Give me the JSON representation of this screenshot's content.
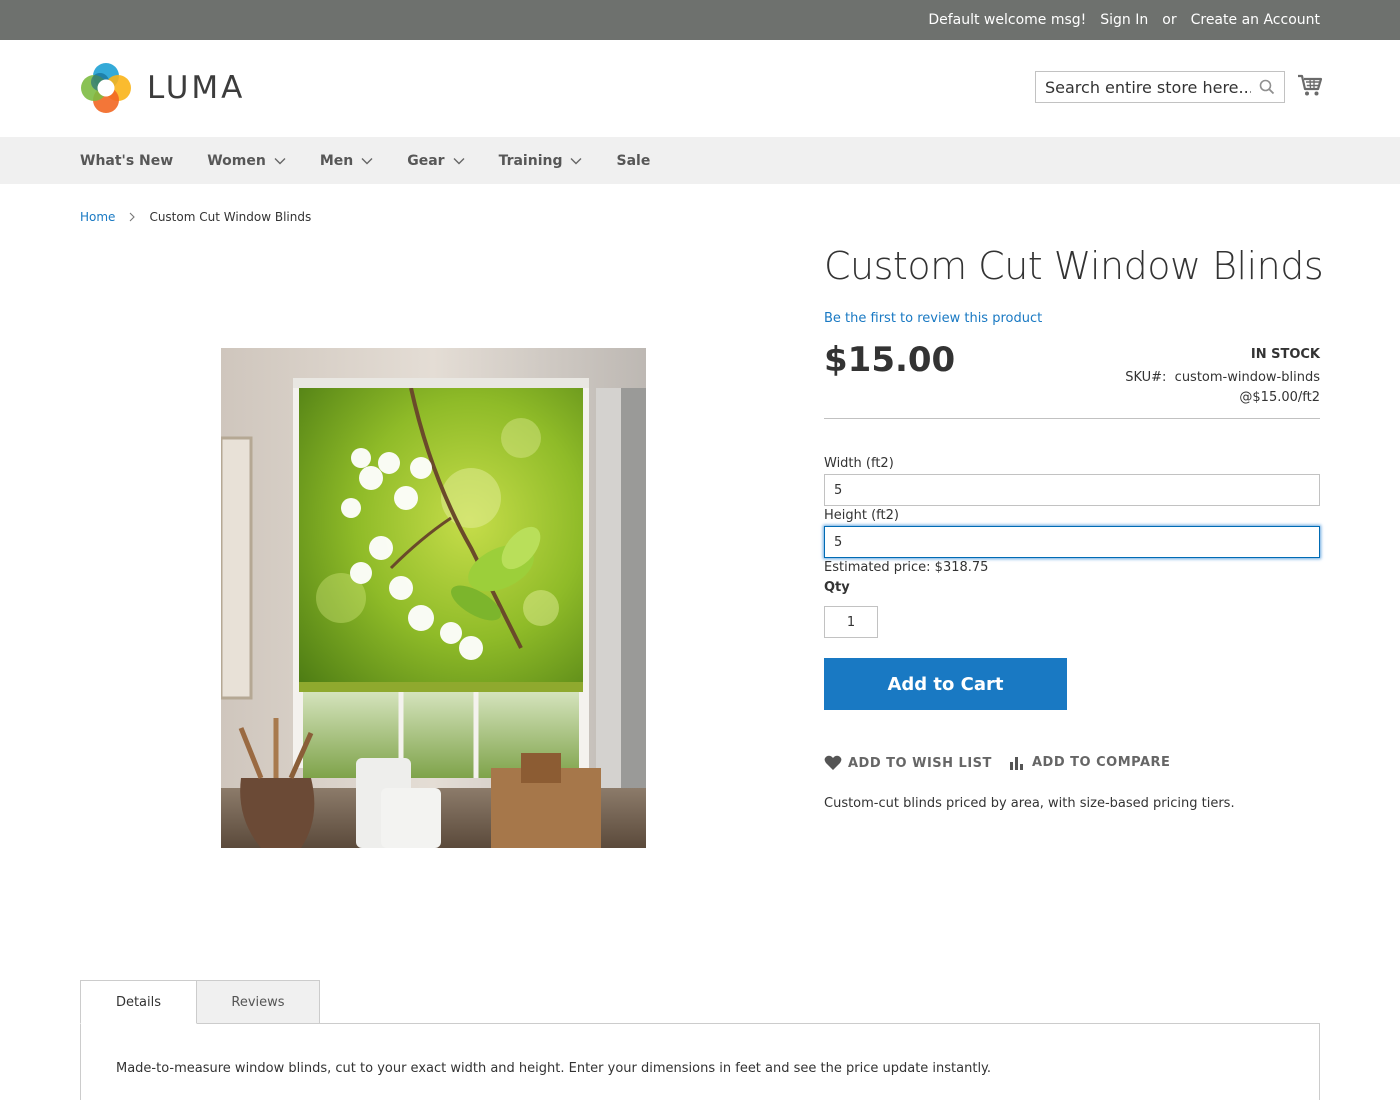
{
  "top_links": {
    "welcome": "Default welcome msg!",
    "sign_in": "Sign In",
    "or": "or",
    "create_account": "Create an Account"
  },
  "header": {
    "logo_text": "LUMA",
    "search_placeholder": "Search entire store here..."
  },
  "nav": {
    "items": [
      {
        "label": "What's New",
        "has_dropdown": false
      },
      {
        "label": "Women",
        "has_dropdown": true
      },
      {
        "label": "Men",
        "has_dropdown": true
      },
      {
        "label": "Gear",
        "has_dropdown": true
      },
      {
        "label": "Training",
        "has_dropdown": true
      },
      {
        "label": "Sale",
        "has_dropdown": false
      }
    ]
  },
  "breadcrumb": {
    "home": "Home",
    "current": "Custom Cut Window Blinds"
  },
  "product": {
    "title": "Custom Cut Window Blinds",
    "review_link": "Be the first to review this product",
    "price": "$15.00",
    "stock": "In stock",
    "sku_label": "SKU#:",
    "sku": "custom-window-blinds",
    "unit_price": "@$15.00/ft2",
    "width_label": "Width (ft2)",
    "width_value": "5",
    "height_label": "Height (ft2)",
    "height_value": "5",
    "estimated_price": "Estimated price: $318.75",
    "qty_label": "Qty",
    "qty_value": "1",
    "add_to_cart": "Add to Cart",
    "wish_list": "Add to Wish List",
    "compare": "Add to Compare",
    "short_description": "Custom-cut blinds priced by area, with size-based pricing tiers."
  },
  "tabs": {
    "details": "Details",
    "reviews": "Reviews",
    "details_content": "Made-to-measure window blinds, cut to your exact width and height. Enter your dimensions in feet and see the price update instantly."
  },
  "colors": {
    "top_bar": "#6e716e",
    "nav_bg": "#f0f0f0",
    "accent": "#1979c3",
    "focus": "#006bb4"
  }
}
